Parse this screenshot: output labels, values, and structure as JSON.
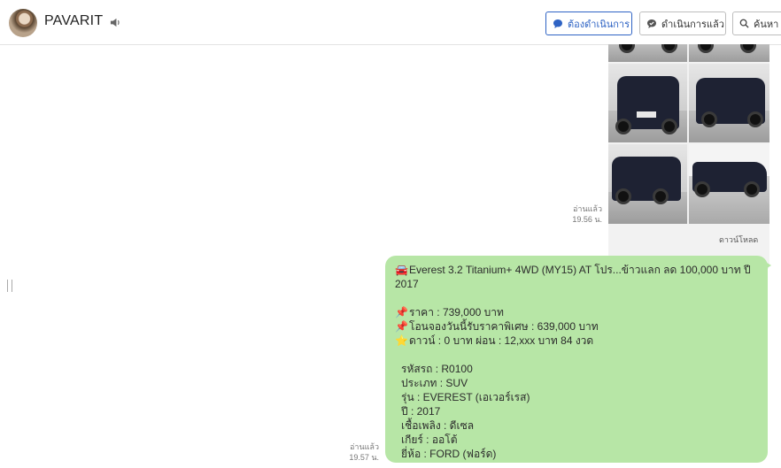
{
  "header": {
    "contact_name": "PAVARIT",
    "buttons": {
      "todo": "ต้องดำเนินการ",
      "done": "ดำเนินการแล้ว",
      "search": "ค้นหา"
    }
  },
  "chat": {
    "photo_message": {
      "read_status": "อ่านแล้ว",
      "time": "19.56 น.",
      "download_label": "ดาวน์โหลด"
    },
    "text_message": {
      "read_status": "อ่านแล้ว",
      "time": "19.57 น.",
      "title_line1": "Everest 3.2 Titanium+ 4WD (MY15) AT โปร...ข้าวแลก ลด 100,000 บาท ปี",
      "title_line2": "2017",
      "price": "ราคา : 739,000 บาท",
      "special_price": "โอนจองวันนี้รับราคาพิเศษ : 639,000 บาท",
      "installment": "ดาวน์ : 0 บาท ผ่อน : 12,xxx บาท 84 งวด",
      "car_code": "รหัสรถ : R0100",
      "car_type": "ประเภท : SUV",
      "model": "รุ่น : EVEREST (เอเวอร์เรส)",
      "year": "ปี : 2017",
      "fuel": "เชื้อเพลิง : ดีเซล",
      "gear": "เกียร์ : ออโต้",
      "brand": "ยี่ห้อ : FORD (ฟอร์ด)"
    }
  },
  "icons": {
    "car_emoji": "🚘",
    "pin_emoji": "📌",
    "star_emoji": "⭐"
  },
  "colors": {
    "bubble": "#b7e6a6",
    "accent": "#2e63c4"
  }
}
